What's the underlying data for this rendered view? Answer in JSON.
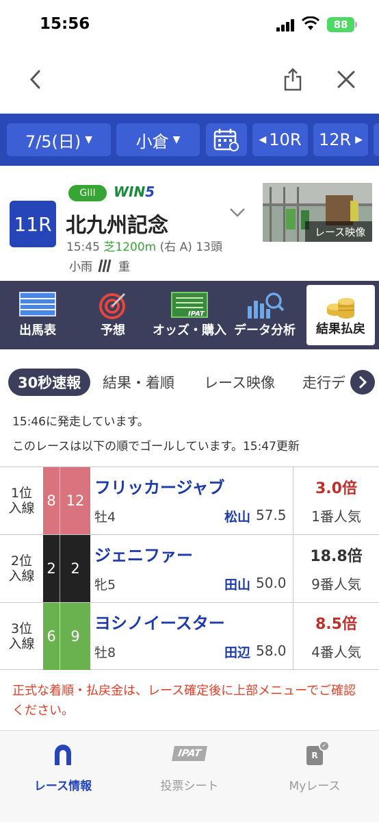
{
  "status": {
    "time": "15:56",
    "battery": "88"
  },
  "race_bar": {
    "date": "7/5(日)",
    "venue": "小倉",
    "prev_race": "10R",
    "next_race": "12R"
  },
  "race": {
    "number": "11R",
    "grade": "GIII",
    "win5_prefix": "WIN",
    "win5_num": "5",
    "name": "北九州記念",
    "time": "15:45",
    "course": "芝1200m",
    "direction": "(右 A)",
    "runners": "13頭",
    "weather": "小雨",
    "track": "重",
    "video_label": "レース映像"
  },
  "menu": [
    {
      "label": "出馬表",
      "icon": "race-card-icon"
    },
    {
      "label": "予想",
      "icon": "target-icon"
    },
    {
      "label": "オッズ・購入",
      "icon": "ipat-odds-icon"
    },
    {
      "label": "データ分析",
      "icon": "chart-search-icon"
    },
    {
      "label": "結果払戻",
      "icon": "coins-icon"
    }
  ],
  "tabs": [
    "30秒速報",
    "結果・着順",
    "レース映像",
    "走行デ"
  ],
  "notice": {
    "line1": "15:46に発走しています。",
    "line2": "このレースは以下の順でゴールしています。15:47更新"
  },
  "results": [
    {
      "rank": "1位",
      "status": "入線",
      "frame": "8",
      "horse_no": "12",
      "frame_color": "#d9737e",
      "name": "フリッカージャブ",
      "sex_age": "牡4",
      "jockey": "松山",
      "weight": "57.5",
      "odds": "3.0倍",
      "popularity": "1番人気",
      "odds_color": "#c0302a"
    },
    {
      "rank": "2位",
      "status": "入線",
      "frame": "2",
      "horse_no": "2",
      "frame_color": "#222222",
      "name": "ジェニファー",
      "sex_age": "牝5",
      "jockey": "田山",
      "weight": "50.0",
      "odds": "18.8倍",
      "popularity": "9番人気",
      "odds_color": "#333333"
    },
    {
      "rank": "3位",
      "status": "入線",
      "frame": "6",
      "horse_no": "9",
      "frame_color": "#6ab150",
      "name": "ヨシノイースター",
      "sex_age": "牡8",
      "jockey": "田辺",
      "weight": "58.0",
      "odds": "8.5倍",
      "popularity": "4番人気",
      "odds_color": "#c0302a"
    }
  ],
  "warning": "正式な着順・払戻金は、レース確定後に上部メニューでご確認ください。",
  "bottom_tabs": [
    {
      "label": "レース情報",
      "icon": "horseshoe-icon"
    },
    {
      "label": "投票シート",
      "icon": "ipat-icon",
      "icon_text": "IPAT"
    },
    {
      "label": "Myレース",
      "icon": "my-race-icon",
      "icon_text": "R"
    }
  ]
}
